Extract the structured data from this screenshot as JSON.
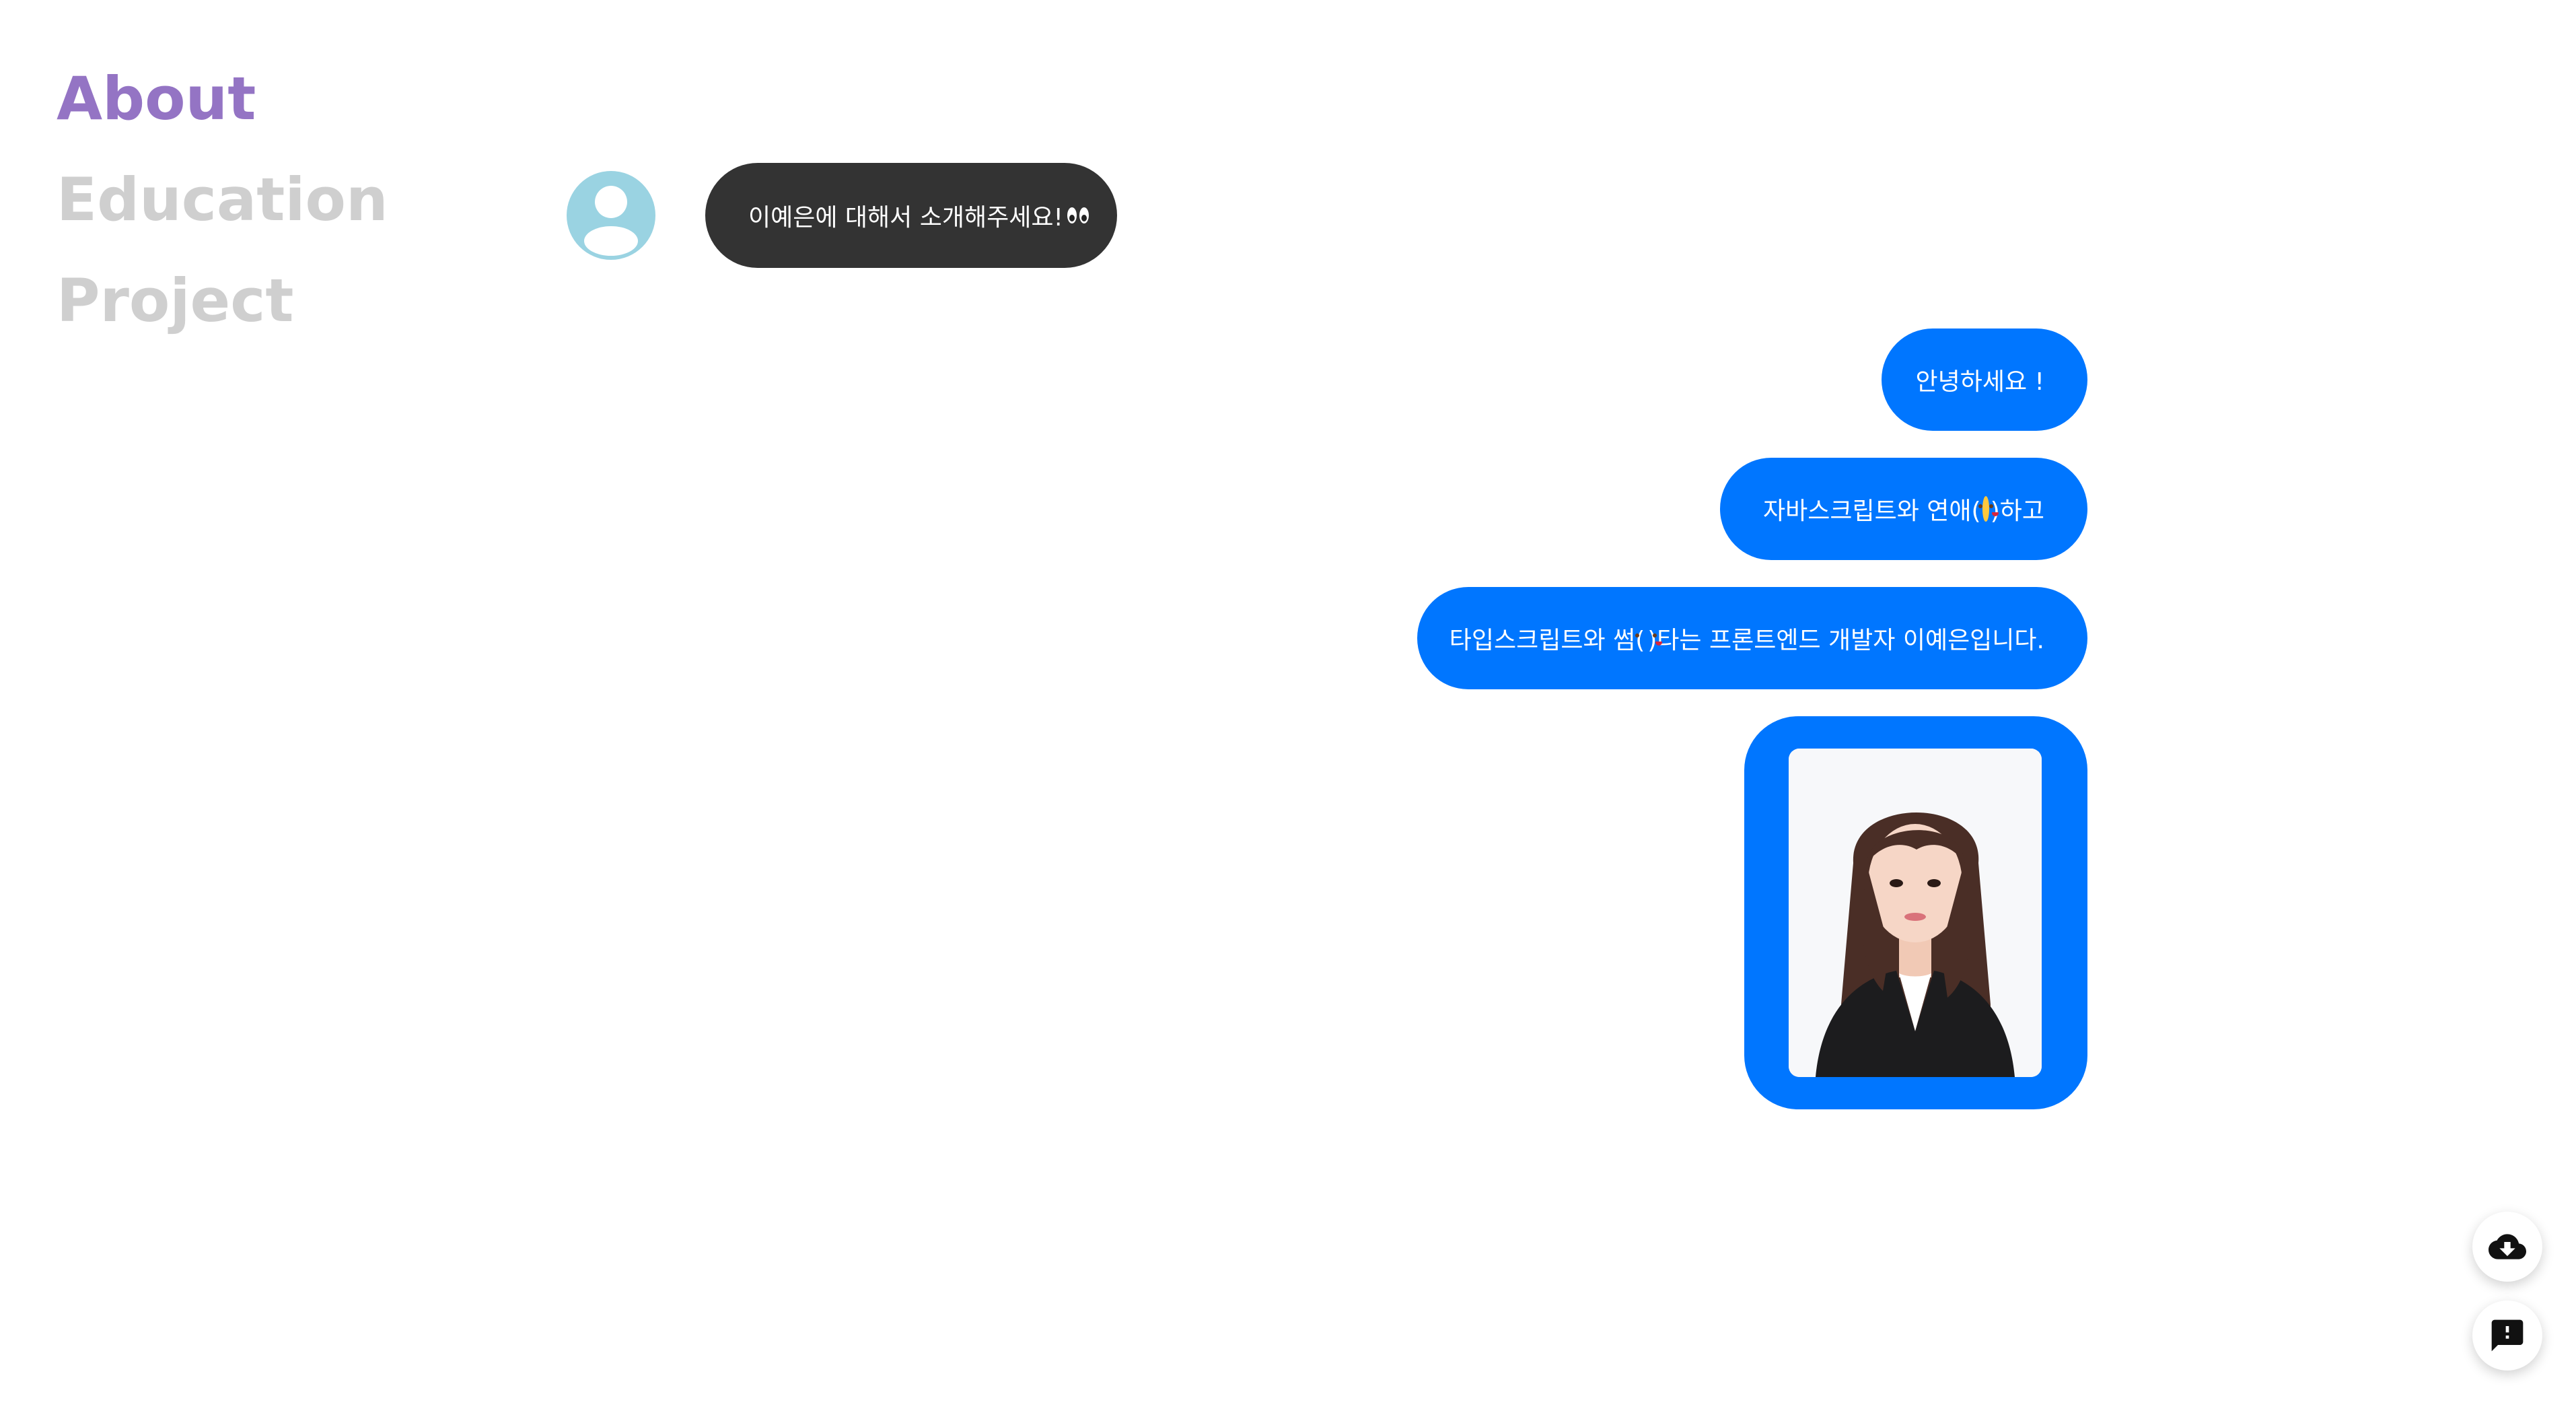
{
  "nav": {
    "items": [
      {
        "label": "About",
        "active": true
      },
      {
        "label": "Education",
        "active": false
      },
      {
        "label": "Project",
        "active": false
      }
    ]
  },
  "chat": {
    "question": {
      "text": "이예은에 대해서 소개해주세요!",
      "trailing_icon": "eyes-emoji"
    },
    "answers": {
      "greeting": {
        "text": "안녕하세요 !"
      },
      "line2": {
        "before": "자바스크립트와 연애(",
        "emoji": "smiling-face-with-hearts-emoji",
        "after": ")하고"
      },
      "line3": {
        "before": "타입스크립트와 썸(",
        "emoji": "face-blowing-kiss-emoji",
        "after": ")타는 프론트엔드 개발자 이예은입니다."
      }
    },
    "photo": {
      "icon": "profile-photo"
    }
  },
  "actions": {
    "download": {
      "icon": "cloud-download-icon"
    },
    "feedback": {
      "icon": "feedback-icon"
    }
  },
  "colors": {
    "accent_purple": "#9474c4",
    "nav_inactive": "#cfcfcf",
    "incoming_bubble": "#333333",
    "outgoing_bubble": "#0076ff",
    "avatar_bg": "#9ad3e2"
  }
}
